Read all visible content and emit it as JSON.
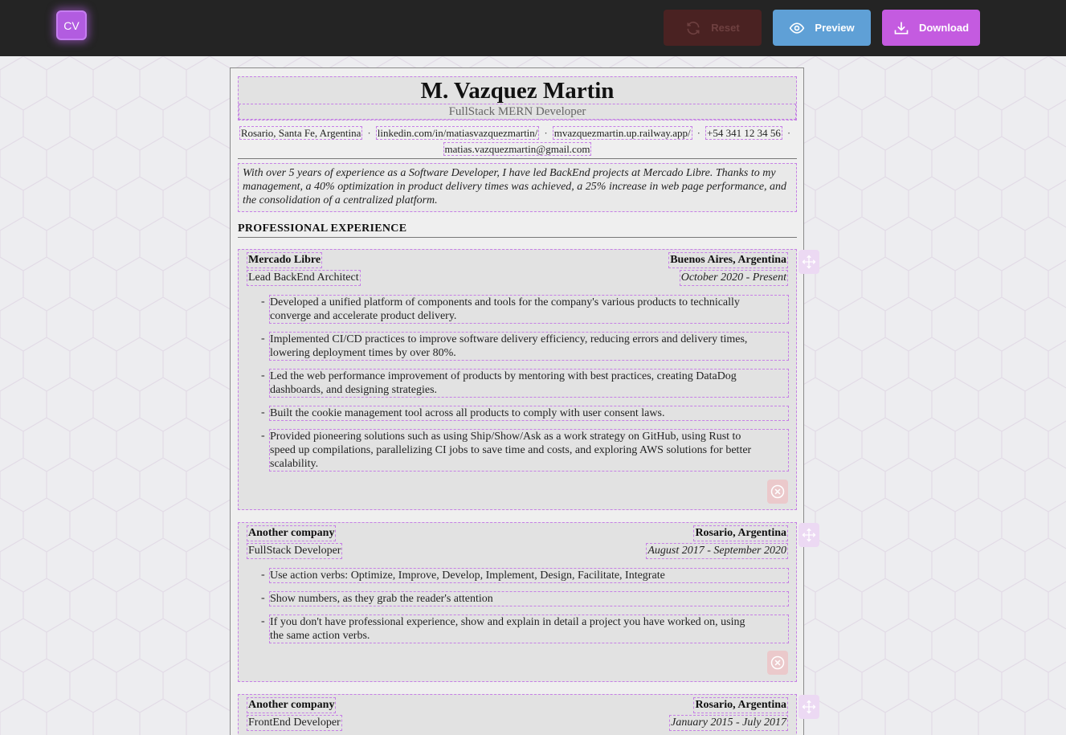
{
  "toolbar": {
    "logo": "CV",
    "reset_label": "Reset",
    "preview_label": "Preview",
    "download_label": "Download"
  },
  "resume": {
    "name": "M. Vazquez Martin",
    "role": "FullStack MERN Developer",
    "contacts": [
      "Rosario, Santa Fe, Argentina",
      "linkedin.com/in/matiasvazquezmartin/",
      "mvazquezmartin.up.railway.app/",
      "+54 341 12 34 56",
      "matias.vazquezmartin@gmail.com"
    ],
    "separator": "·",
    "summary": "With over 5 years of experience as a Software Developer, I have led BackEnd projects at Mercado Libre. Thanks to my management, a 40% optimization in product delivery times was achieved, a 25% increase in web page performance, and the consolidation of a centralized platform.",
    "section_title": "PROFESSIONAL EXPERIENCE",
    "jobs": [
      {
        "company": "Mercado Libre",
        "location": "Buenos Aires, Argentina",
        "title": "Lead BackEnd Architect",
        "dates": "October 2020 - Present",
        "bullets": [
          "Developed a unified platform of components and tools for the company's various products to technically converge and accelerate product delivery.",
          "Implemented CI/CD practices to improve software delivery efficiency, reducing errors and delivery times, lowering deployment times by over 80%.",
          "Led the web performance improvement of products by mentoring with best practices, creating DataDog dashboards, and designing strategies.",
          "Built the cookie management tool across all products to comply with user consent laws.",
          "Provided pioneering solutions such as using Ship/Show/Ask as a work strategy on GitHub, using Rust to speed up compilations, parallelizing CI jobs to save time and costs, and exploring AWS solutions for better scalability."
        ]
      },
      {
        "company": "Another company",
        "location": "Rosario, Argentina",
        "title": "FullStack Developer",
        "dates": "August 2017 - September 2020",
        "bullets": [
          "Use action verbs: Optimize, Improve, Develop, Implement, Design, Facilitate, Integrate",
          "Show numbers, as they grab the reader's attention",
          "If you don't have professional experience, show and explain in detail a project you have worked on, using the same action verbs."
        ]
      },
      {
        "company": "Another company",
        "location": "Rosario, Argentina",
        "title": "FrontEnd Developer",
        "dates": "January 2015 - July 2017",
        "bullets": []
      }
    ]
  }
}
